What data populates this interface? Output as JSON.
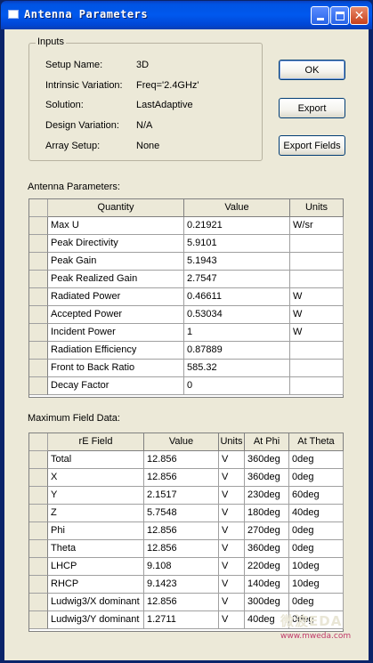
{
  "window": {
    "title": "Antenna Parameters"
  },
  "inputs": {
    "group_title": "Inputs",
    "rows": [
      {
        "label": "Setup Name:",
        "value": "3D"
      },
      {
        "label": "Intrinsic Variation:",
        "value": "Freq='2.4GHz'"
      },
      {
        "label": "Solution:",
        "value": "LastAdaptive"
      },
      {
        "label": "Design Variation:",
        "value": "N/A"
      },
      {
        "label": "Array Setup:",
        "value": "None"
      }
    ]
  },
  "buttons": {
    "ok": "OK",
    "export": "Export",
    "export_fields": "Export Fields"
  },
  "antenna_params": {
    "section_label": "Antenna Parameters:",
    "headers": [
      "Quantity",
      "Value",
      "Units"
    ],
    "rows": [
      [
        "Max U",
        "0.21921",
        "W/sr"
      ],
      [
        "Peak Directivity",
        "5.9101",
        ""
      ],
      [
        "Peak Gain",
        "5.1943",
        ""
      ],
      [
        "Peak Realized Gain",
        "2.7547",
        ""
      ],
      [
        "Radiated Power",
        "0.46611",
        "W"
      ],
      [
        "Accepted Power",
        "0.53034",
        "W"
      ],
      [
        "Incident Power",
        "1",
        "W"
      ],
      [
        "Radiation Efficiency",
        "0.87889",
        ""
      ],
      [
        "Front to Back Ratio",
        "585.32",
        ""
      ],
      [
        "Decay Factor",
        "0",
        ""
      ]
    ]
  },
  "max_field": {
    "section_label": "Maximum Field Data:",
    "headers": [
      "rE Field",
      "Value",
      "Units",
      "At Phi",
      "At Theta"
    ],
    "rows": [
      [
        "Total",
        "12.856",
        "V",
        "360deg",
        "0deg"
      ],
      [
        "X",
        "12.856",
        "V",
        "360deg",
        "0deg"
      ],
      [
        "Y",
        "2.1517",
        "V",
        "230deg",
        "60deg"
      ],
      [
        "Z",
        "5.7548",
        "V",
        "180deg",
        "40deg"
      ],
      [
        "Phi",
        "12.856",
        "V",
        "270deg",
        "0deg"
      ],
      [
        "Theta",
        "12.856",
        "V",
        "360deg",
        "0deg"
      ],
      [
        "LHCP",
        "9.108",
        "V",
        "220deg",
        "10deg"
      ],
      [
        "RHCP",
        "9.1423",
        "V",
        "140deg",
        "10deg"
      ],
      [
        "Ludwig3/X dominant",
        "12.856",
        "V",
        "300deg",
        "0deg"
      ],
      [
        "Ludwig3/Y dominant",
        "1.2711",
        "V",
        "40deg",
        "0deg"
      ]
    ]
  },
  "watermark": {
    "logo": "微波EDA",
    "url": "www.mweda.com"
  },
  "icons": {
    "minimize": "minimize-icon",
    "maximize": "maximize-icon",
    "close": "close-icon",
    "app": "window-icon"
  },
  "colors": {
    "titlebar": "#0058ee",
    "client": "#ece9d8",
    "grid_bg": "#ffffff"
  }
}
